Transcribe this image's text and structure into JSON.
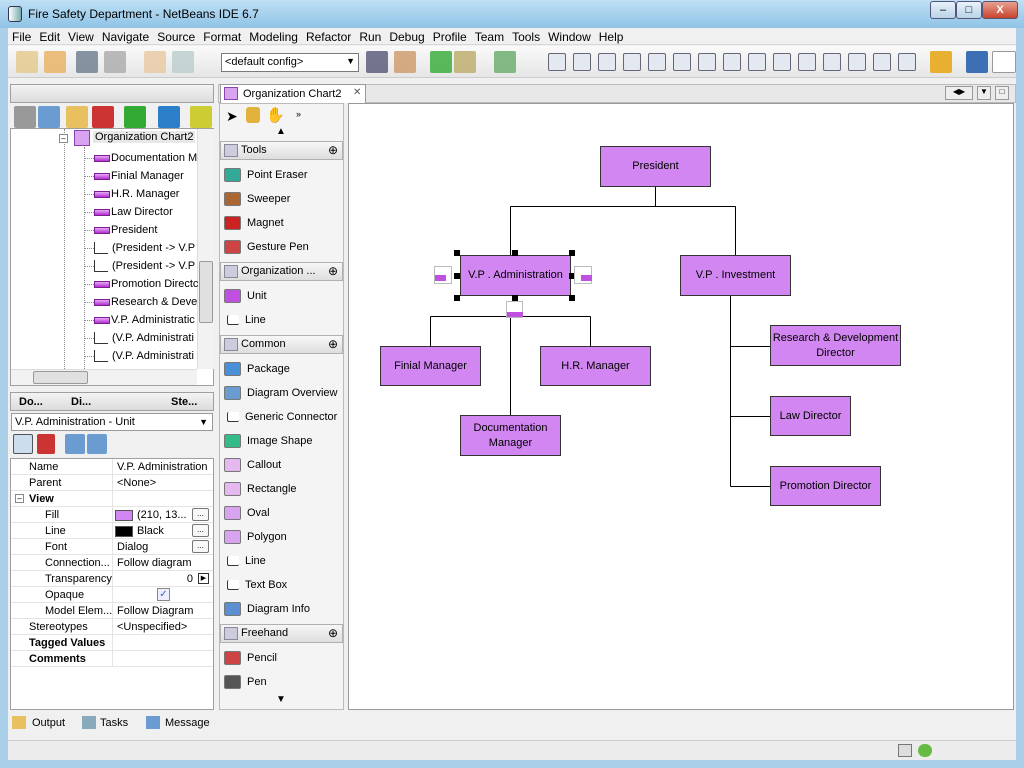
{
  "window": {
    "title": "Fire Safety Department - NetBeans IDE 6.7",
    "min": "–",
    "max": "□",
    "close": "X"
  },
  "menu": [
    "File",
    "Edit",
    "View",
    "Navigate",
    "Source",
    "Format",
    "Modeling",
    "Refactor",
    "Run",
    "Debug",
    "Profile",
    "Team",
    "Tools",
    "Window",
    "Help"
  ],
  "toolbar": {
    "config": "<default config>"
  },
  "project_tree": {
    "root": "Organization Chart2",
    "items": [
      {
        "type": "unit",
        "label": "Documentation M"
      },
      {
        "type": "unit",
        "label": "Finial Manager"
      },
      {
        "type": "unit",
        "label": "H.R. Manager"
      },
      {
        "type": "unit",
        "label": "Law Director"
      },
      {
        "type": "unit",
        "label": "President"
      },
      {
        "type": "line",
        "label": "(President -> V.P"
      },
      {
        "type": "line",
        "label": "(President -> V.P"
      },
      {
        "type": "unit",
        "label": "Promotion Directc"
      },
      {
        "type": "unit",
        "label": "Research & Deve"
      },
      {
        "type": "unit",
        "label": "V.P. Administratic"
      },
      {
        "type": "line",
        "label": "(V.P. Administrati"
      },
      {
        "type": "line",
        "label": "(V.P. Administrati"
      }
    ]
  },
  "properties": {
    "tabs": [
      "Do...",
      "Di...",
      "Ste..."
    ],
    "selector": "V.P. Administration - Unit",
    "rows": [
      {
        "k": "Name",
        "v": "V.P. Administration",
        "indent": 0
      },
      {
        "k": "Parent",
        "v": "<None>",
        "indent": 0
      },
      {
        "k": "View",
        "v": "",
        "indent": 0,
        "group": true
      },
      {
        "k": "Fill",
        "v": "(210, 13...",
        "indent": 1,
        "swatch": "#d286f1",
        "ellipsis": true
      },
      {
        "k": "Line",
        "v": "Black",
        "indent": 1,
        "swatch": "#000000",
        "ellipsis": true
      },
      {
        "k": "Font",
        "v": "Dialog",
        "indent": 1,
        "ellipsis": true
      },
      {
        "k": "Connection...",
        "v": "Follow diagram",
        "indent": 1
      },
      {
        "k": "Transparency",
        "v": "0",
        "indent": 1,
        "right": true
      },
      {
        "k": "Opaque",
        "v": "✓",
        "indent": 1,
        "check": true
      },
      {
        "k": "Model Elem...",
        "v": "Follow Diagram",
        "indent": 1
      },
      {
        "k": "Stereotypes",
        "v": "<Unspecified>",
        "indent": 0
      },
      {
        "k": "Tagged Values",
        "v": "",
        "indent": 0,
        "bold": true
      },
      {
        "k": "Comments",
        "v": "",
        "indent": 0,
        "bold": true
      }
    ]
  },
  "editor_tab": {
    "label": "Organization Chart2"
  },
  "palette": {
    "sections": [
      {
        "title": "Tools",
        "items": [
          {
            "label": "Point Eraser",
            "color": "#3a9"
          },
          {
            "label": "Sweeper",
            "color": "#a63"
          },
          {
            "label": "Magnet",
            "color": "#c22"
          },
          {
            "label": "Gesture Pen",
            "color": "#c44"
          }
        ]
      },
      {
        "title": "Organization ...",
        "items": [
          {
            "label": "Unit",
            "color": "#c050e0"
          },
          {
            "label": "Line",
            "color": "#fff"
          }
        ]
      },
      {
        "title": "Common",
        "items": [
          {
            "label": "Package",
            "color": "#4a90d9"
          },
          {
            "label": "Diagram Overview",
            "color": "#6a9bd1"
          },
          {
            "label": "Generic Connector",
            "color": "#fff"
          },
          {
            "label": "Image Shape",
            "color": "#3b8"
          },
          {
            "label": "Callout",
            "color": "#e6b8f0"
          },
          {
            "label": "Rectangle",
            "color": "#e6b8f0"
          },
          {
            "label": "Oval",
            "color": "#d9a4ef"
          },
          {
            "label": "Polygon",
            "color": "#d9a4ef"
          },
          {
            "label": "Line",
            "color": "#fff"
          },
          {
            "label": "Text Box",
            "color": "#fff"
          },
          {
            "label": "Diagram Info",
            "color": "#5b8fd1"
          }
        ]
      },
      {
        "title": "Freehand",
        "items": [
          {
            "label": "Pencil",
            "color": "#c44"
          },
          {
            "label": "Pen",
            "color": "#555"
          }
        ]
      }
    ]
  },
  "diagram": {
    "fill": "#d286f1",
    "nodes": {
      "president": "President",
      "vp_admin": "V.P . Administration",
      "vp_invest": "V.P . Investment",
      "finial": "Finial Manager",
      "hr": "H.R. Manager",
      "doc": "Documentation Manager",
      "research": "Research & Development Director",
      "law": "Law Director",
      "promo": "Promotion Director"
    }
  },
  "bottom": {
    "output": "Output",
    "tasks": "Tasks",
    "message": "Message"
  }
}
